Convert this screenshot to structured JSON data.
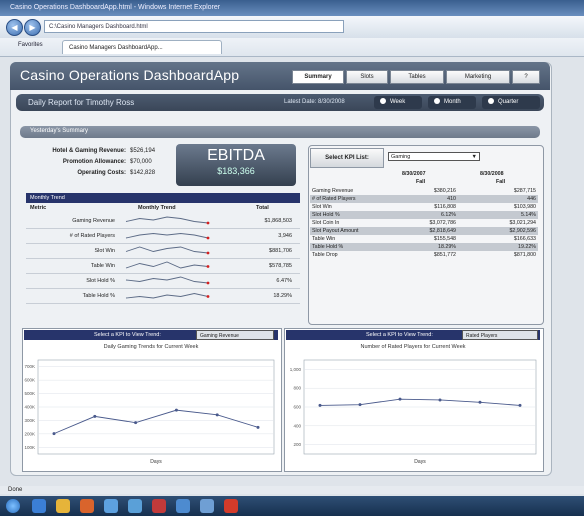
{
  "browser": {
    "title": "Casino Operations DashboardApp.html - Windows Internet Explorer",
    "address": "C:\\Casino Managers Dashboard.html",
    "favorites_label": "Favorites",
    "tab_label": "Casino Managers DashboardApp..."
  },
  "app": {
    "title": "Casino Operations DashboardApp",
    "tabs": [
      "Summary",
      "Slots",
      "Tables",
      "Marketing",
      "?"
    ],
    "report_title": "Daily Report for Timothy Ross",
    "latest_date": "Latest Date: 8/30/2008",
    "periods": [
      "Week",
      "Month",
      "Quarter"
    ]
  },
  "summary": {
    "title": "Yesterday's Summary",
    "net_gaming_label": "Hotel & Gaming Revenue:",
    "net_gaming_value": "$526,194",
    "promo_label": "Promotion Allowance:",
    "promo_value": "$70,000",
    "op_label": "Operating Costs:",
    "op_value": "$142,828",
    "ebitda_label": "EBITDA",
    "ebitda_value": "$183,366"
  },
  "monthly_trend": {
    "title": "Monthly Trend",
    "columns": [
      "Metric",
      "Monthly Trend",
      "Total"
    ],
    "rows": [
      {
        "metric": "Gaming Revenue",
        "total": "$1,868,503",
        "points": [
          3,
          5,
          4,
          6,
          5,
          3,
          2
        ]
      },
      {
        "metric": "# of Rated Players",
        "total": "3,946",
        "points": [
          2,
          4,
          5,
          4,
          5,
          4,
          2
        ]
      },
      {
        "metric": "Slot Win",
        "total": "$881,706",
        "points": [
          3,
          6,
          3,
          5,
          6,
          3,
          2
        ]
      },
      {
        "metric": "Table Win",
        "total": "$578,785",
        "points": [
          2,
          5,
          3,
          6,
          2,
          4,
          3
        ]
      },
      {
        "metric": "Slot Hold %",
        "total": "6.47%",
        "points": [
          4,
          3,
          5,
          4,
          6,
          3,
          2
        ]
      },
      {
        "metric": "Table Hold %",
        "total": "18.29%",
        "points": [
          2,
          3,
          2,
          4,
          3,
          5,
          3
        ]
      }
    ]
  },
  "kpi": {
    "label": "Select KPI List:",
    "selected": "Gaming",
    "col1": "8/30/2007",
    "col2": "8/30/2008",
    "sub1": "Fall",
    "sub2": "Fall",
    "rows": [
      {
        "name": "Gaming Revenue",
        "v1": "$380,216",
        "v2": "$287,715"
      },
      {
        "name": "# of Rated Players",
        "v1": "410",
        "v2": "446"
      },
      {
        "name": "Slot Win",
        "v1": "$116,808",
        "v2": "$103,980"
      },
      {
        "name": "Slot Hold %",
        "v1": "6.12%",
        "v2": "5.14%"
      },
      {
        "name": "Slot Coin In",
        "v1": "$3,072,786",
        "v2": "$3,021,294"
      },
      {
        "name": "Slot Payout Amount",
        "v1": "$2,818,649",
        "v2": "$2,902,596"
      },
      {
        "name": "Table Win",
        "v1": "$155,548",
        "v2": "$166,633"
      },
      {
        "name": "Table Hold %",
        "v1": "18.29%",
        "v2": "19.22%"
      },
      {
        "name": "Table Drop",
        "v1": "$851,772",
        "v2": "$871,800"
      }
    ]
  },
  "trend_left": {
    "header": "Select a KPI to View Trend:",
    "dropdown": "Gaming Revenue",
    "title": "Daily Gaming Trends for Current Week",
    "xlabel": "Days"
  },
  "trend_right": {
    "header": "Select a KPI to View Trend:",
    "dropdown": "Rated Players",
    "title": "Number of Rated Players for Current Week",
    "xlabel": "Days"
  },
  "chart_data": [
    {
      "type": "line",
      "title": "Daily Gaming Trends for Current Week",
      "xlabel": "Days",
      "ylabel": "",
      "yticks": [
        "700K",
        "600K",
        "500K",
        "400K",
        "300K",
        "200K",
        "100K"
      ],
      "ylim": [
        100,
        700
      ],
      "values": [
        230,
        340,
        300,
        380,
        350,
        270
      ],
      "color": "#4a5a8c"
    },
    {
      "type": "line",
      "title": "Number of Rated Players for Current Week",
      "xlabel": "Days",
      "ylabel": "",
      "yticks": [
        "1,000",
        "800",
        "600",
        "400",
        "200"
      ],
      "ylim": [
        0,
        1200
      ],
      "values": [
        620,
        630,
        700,
        690,
        660,
        620
      ],
      "color": "#4a5a8c"
    }
  ],
  "status": {
    "text": "Done"
  }
}
